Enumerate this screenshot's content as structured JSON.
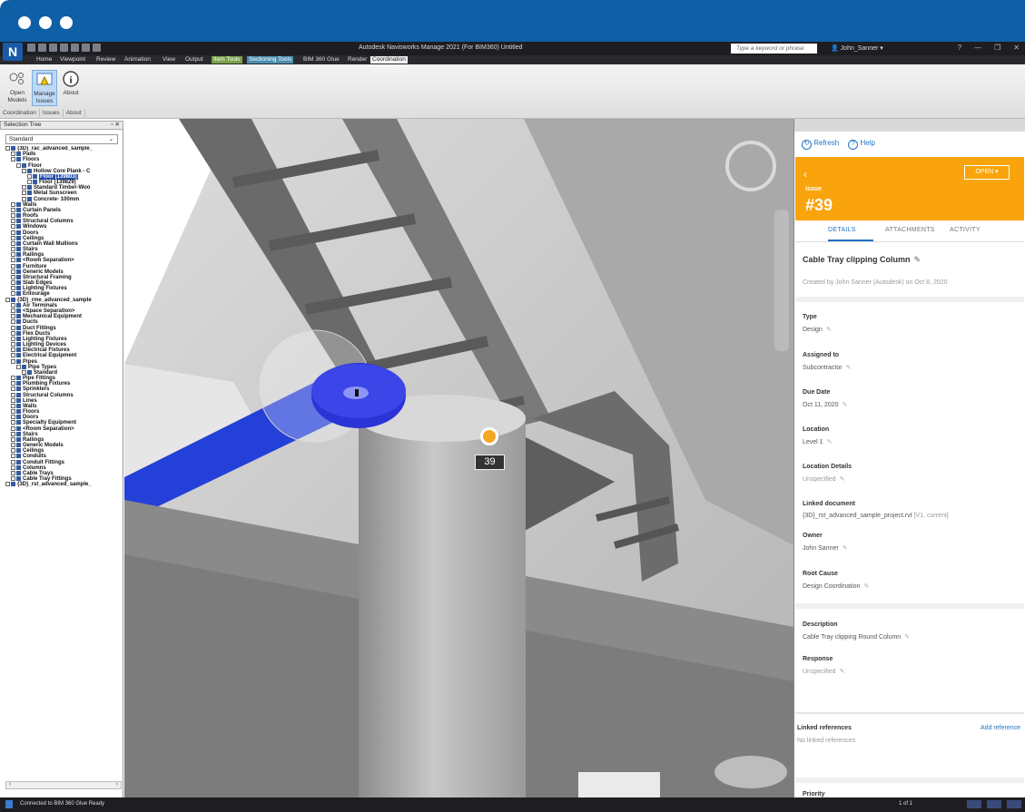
{
  "app": {
    "title": "Autodesk Navisworks Manage 2021 (For BIM360)   Untitled",
    "search_placeholder": "Type a keyword or phrase",
    "user_name": "John_Sanner",
    "logo_letter": "N"
  },
  "tabs": [
    "Home",
    "Viewpoint",
    "Review",
    "Animation",
    "View",
    "Output",
    "Item Tools",
    "Sectioning Tools",
    "BIM 360 Glue",
    "Render",
    "Coordination"
  ],
  "ribbon": {
    "buttons": [
      {
        "label": "Open\nModels",
        "icon": "open-models-icon"
      },
      {
        "label": "Manage\nIssues",
        "icon": "manage-issues-icon"
      },
      {
        "label": "About",
        "icon": "info-icon"
      }
    ],
    "groups": [
      "Coordination",
      "Issues",
      "About"
    ]
  },
  "selection_tree": {
    "title": "Selection Tree",
    "mode": "Standard",
    "items": [
      {
        "d": 0,
        "t": "{3D}_rac_advanced_sample_"
      },
      {
        "d": 1,
        "t": "Pads"
      },
      {
        "d": 1,
        "t": "Floors"
      },
      {
        "d": 2,
        "t": "Floor"
      },
      {
        "d": 3,
        "t": "Hollow Core Plank - C"
      },
      {
        "d": 4,
        "t": "Floor [139803]",
        "hl": true
      },
      {
        "d": 4,
        "t": "Floor [139829]"
      },
      {
        "d": 3,
        "t": "Standard Timber-Woo"
      },
      {
        "d": 3,
        "t": "Metal Sunscreen"
      },
      {
        "d": 3,
        "t": "Concrete- 100mm"
      },
      {
        "d": 1,
        "t": "Walls"
      },
      {
        "d": 1,
        "t": "Curtain Panels"
      },
      {
        "d": 1,
        "t": "Roofs"
      },
      {
        "d": 1,
        "t": "Structural Columns"
      },
      {
        "d": 1,
        "t": "Windows"
      },
      {
        "d": 1,
        "t": "Doors"
      },
      {
        "d": 1,
        "t": "Ceilings"
      },
      {
        "d": 1,
        "t": "Curtain Wall Mullions"
      },
      {
        "d": 1,
        "t": "Stairs"
      },
      {
        "d": 1,
        "t": "Railings"
      },
      {
        "d": 1,
        "t": "<Room Separation>"
      },
      {
        "d": 1,
        "t": "Furniture"
      },
      {
        "d": 1,
        "t": "Generic Models"
      },
      {
        "d": 1,
        "t": "Structural Framing"
      },
      {
        "d": 1,
        "t": "Slab Edges"
      },
      {
        "d": 1,
        "t": "Lighting Fixtures"
      },
      {
        "d": 1,
        "t": "Entourage"
      },
      {
        "d": 0,
        "t": "{3D}_rme_advanced_sample"
      },
      {
        "d": 1,
        "t": "Air Terminals"
      },
      {
        "d": 1,
        "t": "<Space Separation>"
      },
      {
        "d": 1,
        "t": "Mechanical Equipment"
      },
      {
        "d": 1,
        "t": "Ducts"
      },
      {
        "d": 1,
        "t": "Duct Fittings"
      },
      {
        "d": 1,
        "t": "Flex Ducts"
      },
      {
        "d": 1,
        "t": "Lighting Fixtures"
      },
      {
        "d": 1,
        "t": "Lighting Devices"
      },
      {
        "d": 1,
        "t": "Electrical Fixtures"
      },
      {
        "d": 1,
        "t": "Electrical Equipment"
      },
      {
        "d": 1,
        "t": "Pipes"
      },
      {
        "d": 2,
        "t": "Pipe Types"
      },
      {
        "d": 3,
        "t": "Standard"
      },
      {
        "d": 1,
        "t": "Pipe Fittings"
      },
      {
        "d": 1,
        "t": "Plumbing Fixtures"
      },
      {
        "d": 1,
        "t": "Sprinklers"
      },
      {
        "d": 1,
        "t": "Structural Columns"
      },
      {
        "d": 1,
        "t": "Lines"
      },
      {
        "d": 1,
        "t": "Walls"
      },
      {
        "d": 1,
        "t": "Floors"
      },
      {
        "d": 1,
        "t": "Doors"
      },
      {
        "d": 1,
        "t": "Specialty Equipment"
      },
      {
        "d": 1,
        "t": "<Room Separation>"
      },
      {
        "d": 1,
        "t": "Stairs"
      },
      {
        "d": 1,
        "t": "Railings"
      },
      {
        "d": 1,
        "t": "Generic Models"
      },
      {
        "d": 1,
        "t": "Ceilings"
      },
      {
        "d": 1,
        "t": "Conduits"
      },
      {
        "d": 1,
        "t": "Conduit Fittings"
      },
      {
        "d": 1,
        "t": "Columns"
      },
      {
        "d": 1,
        "t": "Cable Trays"
      },
      {
        "d": 1,
        "t": "Cable Tray Fittings"
      },
      {
        "d": 0,
        "t": "{3D}_rst_advanced_sample_"
      }
    ]
  },
  "viewport": {
    "issue_number_badge": "39",
    "pin_color": "#f5a623"
  },
  "issue_panel": {
    "refresh_label": "Refresh",
    "help_label": "Help",
    "status": "OPEN",
    "kind": "Issue",
    "number": "#39",
    "tabs": [
      "DETAILS",
      "ATTACHMENTS",
      "ACTIVITY"
    ],
    "title": "Cable Tray clipping Column",
    "created_by": "Created by John Sanner (Autodesk) on Oct 8, 2020",
    "type_label": "Type",
    "type_value": "Design",
    "assigned_label": "Assigned to",
    "assigned_value": "Subcontractor",
    "due_label": "Due Date",
    "due_value": "Oct 11, 2020",
    "location_label": "Location",
    "location_value": "Level 1",
    "location_details_label": "Location Details",
    "location_details_value": "Unspecified",
    "linked_doc_label": "Linked document",
    "linked_doc_value": "{3D}_rst_advanced_sample_project.rvt",
    "linked_doc_version": "[V1, current]",
    "owner_label": "Owner",
    "owner_value": "John Sanner",
    "root_cause_label": "Root Cause",
    "root_cause_value": "Design Coordination",
    "description_label": "Description",
    "description_value": "Cable Tray clipping Round Column",
    "response_label": "Response",
    "response_value": "Unspecified",
    "linked_refs_label": "Linked references",
    "add_reference": "Add reference",
    "no_linked_refs": "No linked references",
    "priority_label": "Priority",
    "accent": "#f9a40c",
    "link_color": "#1f74c3"
  },
  "status_bar": {
    "text": "Connected to BIM 360 Glue    Ready",
    "page": "1 of 1"
  }
}
